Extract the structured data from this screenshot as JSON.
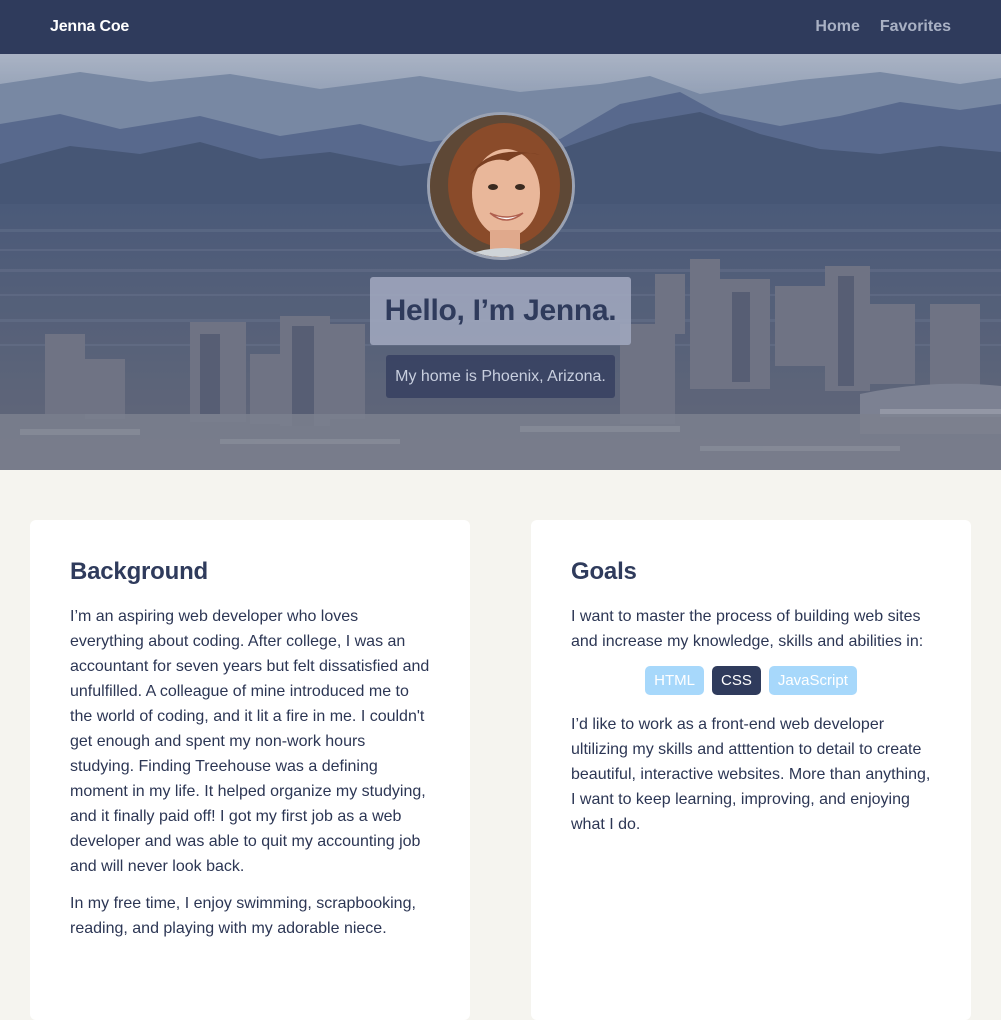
{
  "nav": {
    "brand": "Jenna Coe",
    "links": [
      "Home",
      "Favorites"
    ]
  },
  "hero": {
    "title": "Hello, I’m Jenna.",
    "subtitle": "My home is Phoenix, Arizona."
  },
  "background": {
    "heading": "Background",
    "paragraphs": [
      "I’m an aspiring web developer who loves everything about coding. After college, I was an accountant for seven years but felt dissatisfied and unfulfilled. A colleague of mine introduced me to the world of coding, and it lit a fire in me. I couldn't get enough and spent my non-work hours studying. Finding Treehouse was a defining moment in my life. It helped organize my studying, and it finally paid off! I got my first job as a web developer and was able to quit my accounting job and will never look back.",
      "In my free time, I enjoy swimming, scrapbooking, reading, and playing with my adorable niece."
    ]
  },
  "goals": {
    "heading": "Goals",
    "intro": "I want to master the process of building web sites and increase my knowledge, skills and abilities in:",
    "tags": [
      "HTML",
      "CSS",
      "JavaScript"
    ],
    "outro": "I’d like to work as a front-end web developer ultilizing my skills and atttention to detail to create beautiful, interactive websites. More than anything, I want to keep learning, improving, and enjoying what I do."
  },
  "colors": {
    "navbar": "#2f3b5c",
    "page_bg": "#f5f4ef",
    "tag_light": "#a7d8fb",
    "tag_dark": "#2f3b5c"
  }
}
